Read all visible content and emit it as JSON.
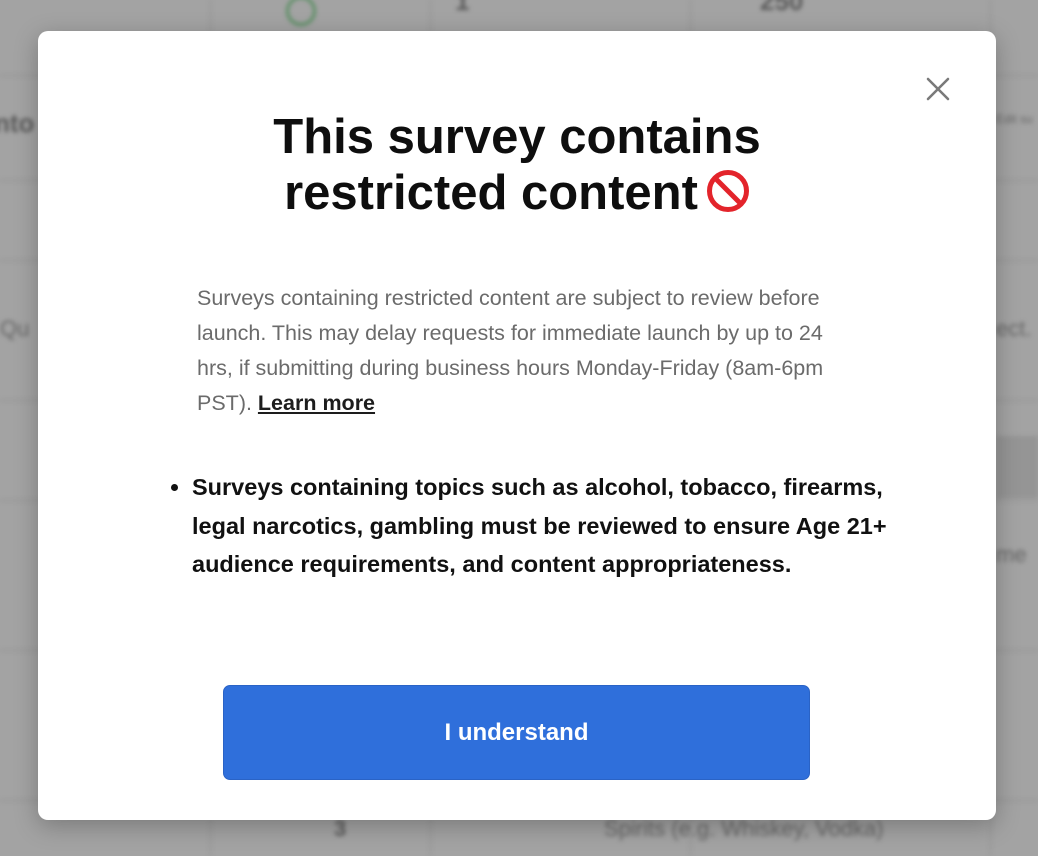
{
  "background": {
    "top_row": {
      "count": "1",
      "amount": "250"
    },
    "left_fragments": [
      "nto",
      "Qu"
    ],
    "right_fragments": [
      "Edit su",
      "ect.",
      "me"
    ],
    "bottom_row": {
      "count": "3",
      "label": "Spirits (e.g. Whiskey, Vodka)"
    }
  },
  "modal": {
    "title_line1": "This survey contains",
    "title_line2": "restricted content",
    "title_icon": "no-entry-icon",
    "description": "Surveys containing restricted content are subject to review before launch. This may delay requests for immediate launch by up to 24 hrs, if submitting during business hours Monday-Friday (8am-6pm PST). ",
    "learn_more_label": "Learn more",
    "bullets": [
      "Surveys containing topics such as alcohol, tobacco, firearms, legal narcotics, gambling must be reviewed to ensure Age 21+ audience requirements, and content appropriateness."
    ],
    "confirm_label": "I understand",
    "close_icon": "close-icon"
  },
  "colors": {
    "primary": "#2f6fdb",
    "overlay": "#a3a3a3",
    "no_entry_red": "#e3242b"
  }
}
